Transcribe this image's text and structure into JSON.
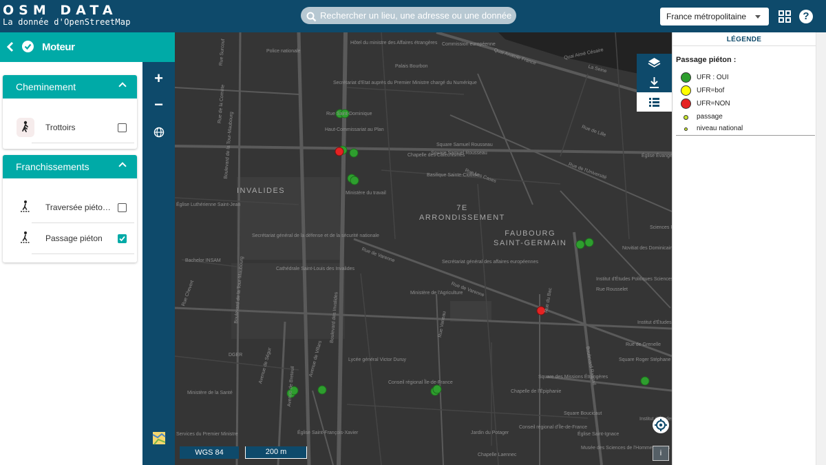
{
  "header": {
    "logo_title": "OSM DATA",
    "logo_subtitle": "La donnée d'OpenStreetMap",
    "search_placeholder": "Rechercher un lieu, une adresse ou une donnée",
    "region_selected": "France métropolitaine",
    "help_label": "?"
  },
  "panel": {
    "title": "Moteur",
    "sections": [
      {
        "title": "Cheminement",
        "items": [
          {
            "label": "Trottoirs",
            "icon": "pedestrian-icon",
            "checked": false
          }
        ]
      },
      {
        "title": "Franchissements",
        "items": [
          {
            "label": "Traversée piéto…",
            "icon": "crossing-icon",
            "checked": false
          },
          {
            "label": "Passage piéton",
            "icon": "crosswalk-icon",
            "checked": true
          }
        ]
      }
    ]
  },
  "tools": {
    "zoom_in": "+",
    "zoom_out": "−"
  },
  "map": {
    "districts": [
      "INVALIDES",
      "7E\nARRONDISSEMENT",
      "FAUBOURG\nSAINT-GERMAIN"
    ],
    "streets": [
      "Quai Anatole France",
      "La Seine",
      "Rue Saint-Dominique",
      "Rue de Varenne",
      "Rue de Varenne",
      "Rue Las Cases",
      "Rue de l'Université",
      "Rue de Lille",
      "Boulevard des Invalides",
      "Boulevard de la Tour-Maubourg",
      "Boulevard de la Tour-Maubourg",
      "Boulevard Raspail",
      "Rue Vaneau",
      "Avenue de Ségur",
      "Avenue de Villars",
      "Avenue de Breteuil",
      "Rue du Bac",
      "Rue Chevert",
      "Rue de Grenelle",
      "Rue de la Comète",
      "Rue Surcouf",
      "Rue Rousselet",
      "Quai Aimé Césaire"
    ],
    "pois": [
      "Hôtel du ministre des Affaires étrangères",
      "Palais Bourbon",
      "Commission européenne",
      "Secrétariat d'Etat auprès du Premier Ministre chargé du Numérique",
      "Police nationale",
      "Haut-Commissariat au Plan",
      "Chapelle des Catéchismes",
      "Square Samuel Rousseau",
      "Basilique Sainte-Clotilde",
      "Ministère du travail",
      "Église Luthérienne Saint-Jean",
      "Secrétariat général de la défense et de la sécurité nationale",
      "Bachelor INSAM",
      "Cathédrale Saint-Louis des Invalides",
      "Secrétariat général des affaires européennes",
      "Ministère de l'Agriculture",
      "DGER",
      "Lycée général Victor Duruy",
      "Ministère de la Santé",
      "Conseil régional Île-de-France",
      "Chapelle de l'Épiphanie",
      "Square des Missions Étrangères",
      "Square Boucicaut",
      "Église Saint-François-Xavier",
      "Jardin du Potager",
      "Chapelle Laennec",
      "Église Saint-Ignace",
      "Services du Premier Ministre",
      "Institut d'Études Politiques Sciences Po École du Doctorat",
      "Novitiat des Dominicains",
      "Sciences Po René Rémond",
      "Église Évangélique Baptiste",
      "Square Roger Stéphane",
      "Institut d'Études Politiques",
      "Institut d'Études Politiques",
      "Musée des Sciences de l'Homme EHESS",
      "Conseil régional d'Île-de-France",
      "Square Samuel Rousseau"
    ],
    "crs_label": "WGS 84",
    "scale_label": "200 m",
    "info_label": "i"
  },
  "legend": {
    "title": "LÉGENDE",
    "subtitle": "Passage piéton :",
    "entries": [
      {
        "label": "UFR : OUI",
        "color": "#2e9e2e"
      },
      {
        "label": "UFR=bof",
        "color": "#ffff00"
      },
      {
        "label": "UFR=NON",
        "color": "#e52222"
      },
      {
        "label": "passage",
        "color": "#c8e62e"
      },
      {
        "label": "niveau national",
        "color": "#c8e62e"
      }
    ]
  },
  "colors": {
    "header": "#0e4a6b",
    "accent": "#00aaa7",
    "map_bg": "#353535"
  }
}
